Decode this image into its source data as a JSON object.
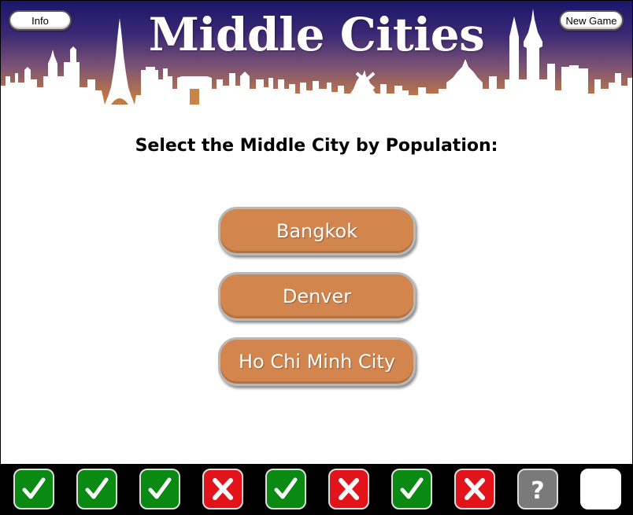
{
  "header": {
    "title": "Middle Cities",
    "info_label": "Info",
    "new_game_label": "New Game"
  },
  "prompt": "Select the Middle City by Population:",
  "choices": [
    "Bangkok",
    "Denver",
    "Ho Chi Minh City"
  ],
  "progress": [
    {
      "status": "correct",
      "icon": "check-icon"
    },
    {
      "status": "correct",
      "icon": "check-icon"
    },
    {
      "status": "correct",
      "icon": "check-icon"
    },
    {
      "status": "wrong",
      "icon": "x-icon"
    },
    {
      "status": "correct",
      "icon": "check-icon"
    },
    {
      "status": "wrong",
      "icon": "x-icon"
    },
    {
      "status": "correct",
      "icon": "check-icon"
    },
    {
      "status": "wrong",
      "icon": "x-icon"
    },
    {
      "status": "current",
      "icon": "question-icon"
    },
    {
      "status": "empty",
      "icon": ""
    }
  ],
  "colors": {
    "choice_fill": "#d2864e",
    "correct": "#0a8a12",
    "wrong": "#e0141a",
    "current": "#7a7a7a"
  }
}
